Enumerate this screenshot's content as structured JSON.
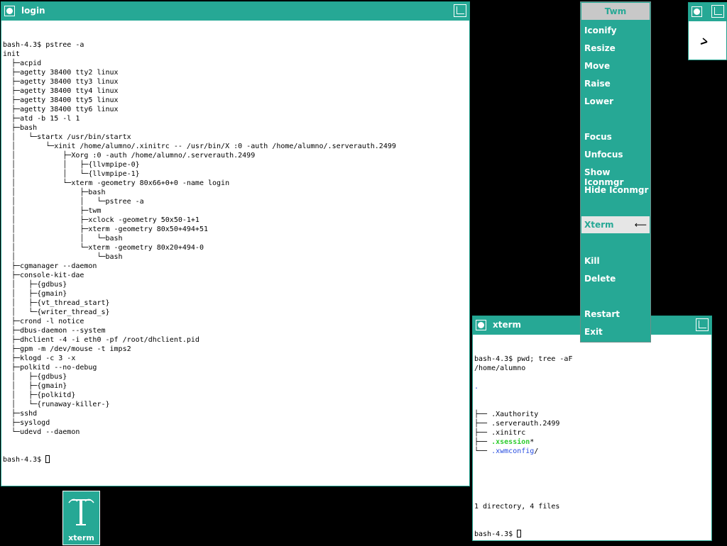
{
  "login_window": {
    "title": "login",
    "lines": [
      "bash-4.3$ pstree -a",
      "init",
      "  ├─acpid",
      "  ├─agetty 38400 tty2 linux",
      "  ├─agetty 38400 tty3 linux",
      "  ├─agetty 38400 tty4 linux",
      "  ├─agetty 38400 tty5 linux",
      "  ├─agetty 38400 tty6 linux",
      "  ├─atd -b 15 -l 1",
      "  ├─bash",
      "  │   └─startx /usr/bin/startx",
      "  │       └─xinit /home/alumno/.xinitrc -- /usr/bin/X :0 -auth /home/alumno/.serverauth.2499",
      "  │           ├─Xorg :0 -auth /home/alumno/.serverauth.2499",
      "  │           │   ├─{llvmpipe-0}",
      "  │           │   └─{llvmpipe-1}",
      "  │           └─xterm -geometry 80x66+0+0 -name login",
      "  │               ├─bash",
      "  │               │   └─pstree -a",
      "  │               ├─twm",
      "  │               ├─xclock -geometry 50x50-1+1",
      "  │               ├─xterm -geometry 80x50+494+51",
      "  │               │   └─bash",
      "  │               └─xterm -geometry 80x20+494-0",
      "  │                   └─bash",
      "  ├─cgmanager --daemon",
      "  ├─console-kit-dae",
      "  │   ├─{gdbus}",
      "  │   ├─{gmain}",
      "  │   ├─{vt_thread_start}",
      "  │   └─{writer_thread_s}",
      "  ├─crond -l notice",
      "  ├─dbus-daemon --system",
      "  ├─dhclient -4 -i eth0 -pf /root/dhclient.pid",
      "  ├─gpm -m /dev/mouse -t imps2",
      "  ├─klogd -c 3 -x",
      "  ├─polkitd --no-debug",
      "  │   ├─{gdbus}",
      "  │   ├─{gmain}",
      "  │   ├─{polkitd}",
      "  │   └─{runaway-killer-}",
      "  ├─sshd",
      "  ├─syslogd",
      "  └─udevd --daemon"
    ],
    "prompt": "bash-4.3$ "
  },
  "xterm_window": {
    "title": "xterm",
    "lines": [
      "bash-4.3$ pwd; tree -aF",
      "/home/alumno",
      "",
      "."
    ],
    "tree_prefix_mid": "├── ",
    "tree_prefix_last": "└── ",
    "entries": [
      {
        "name": ".Xauthority",
        "suffix": ""
      },
      {
        "name": ".serverauth.2499",
        "suffix": ""
      },
      {
        "name": ".xinitrc",
        "suffix": ""
      },
      {
        "name": ".xsession",
        "suffix": "*"
      },
      {
        "name": ".xwmconfig",
        "suffix": "/"
      }
    ],
    "summary": "1 directory, 4 files",
    "prompt": "bash-4.3$ "
  },
  "twm_menu": {
    "title": "Twm",
    "items": {
      "iconify": "Iconify",
      "resize": "Resize",
      "move": "Move",
      "raise": "Raise",
      "lower": "Lower",
      "focus": "Focus",
      "unfocus": "Unfocus",
      "show_iconmgr": "Show Iconmgr",
      "hide_iconmgr": "Hide Iconmgr",
      "xterm": "Xterm",
      "kill": "Kill",
      "delete": "Delete",
      "restart": "Restart",
      "exit": "Exit"
    },
    "submenu_arrow": "⟵"
  },
  "icon": {
    "label": "xterm",
    "glyph": "T"
  },
  "colors": {
    "teal": "#26a895",
    "executable": "#2ecc2e",
    "directory": "#2a4fe0"
  }
}
